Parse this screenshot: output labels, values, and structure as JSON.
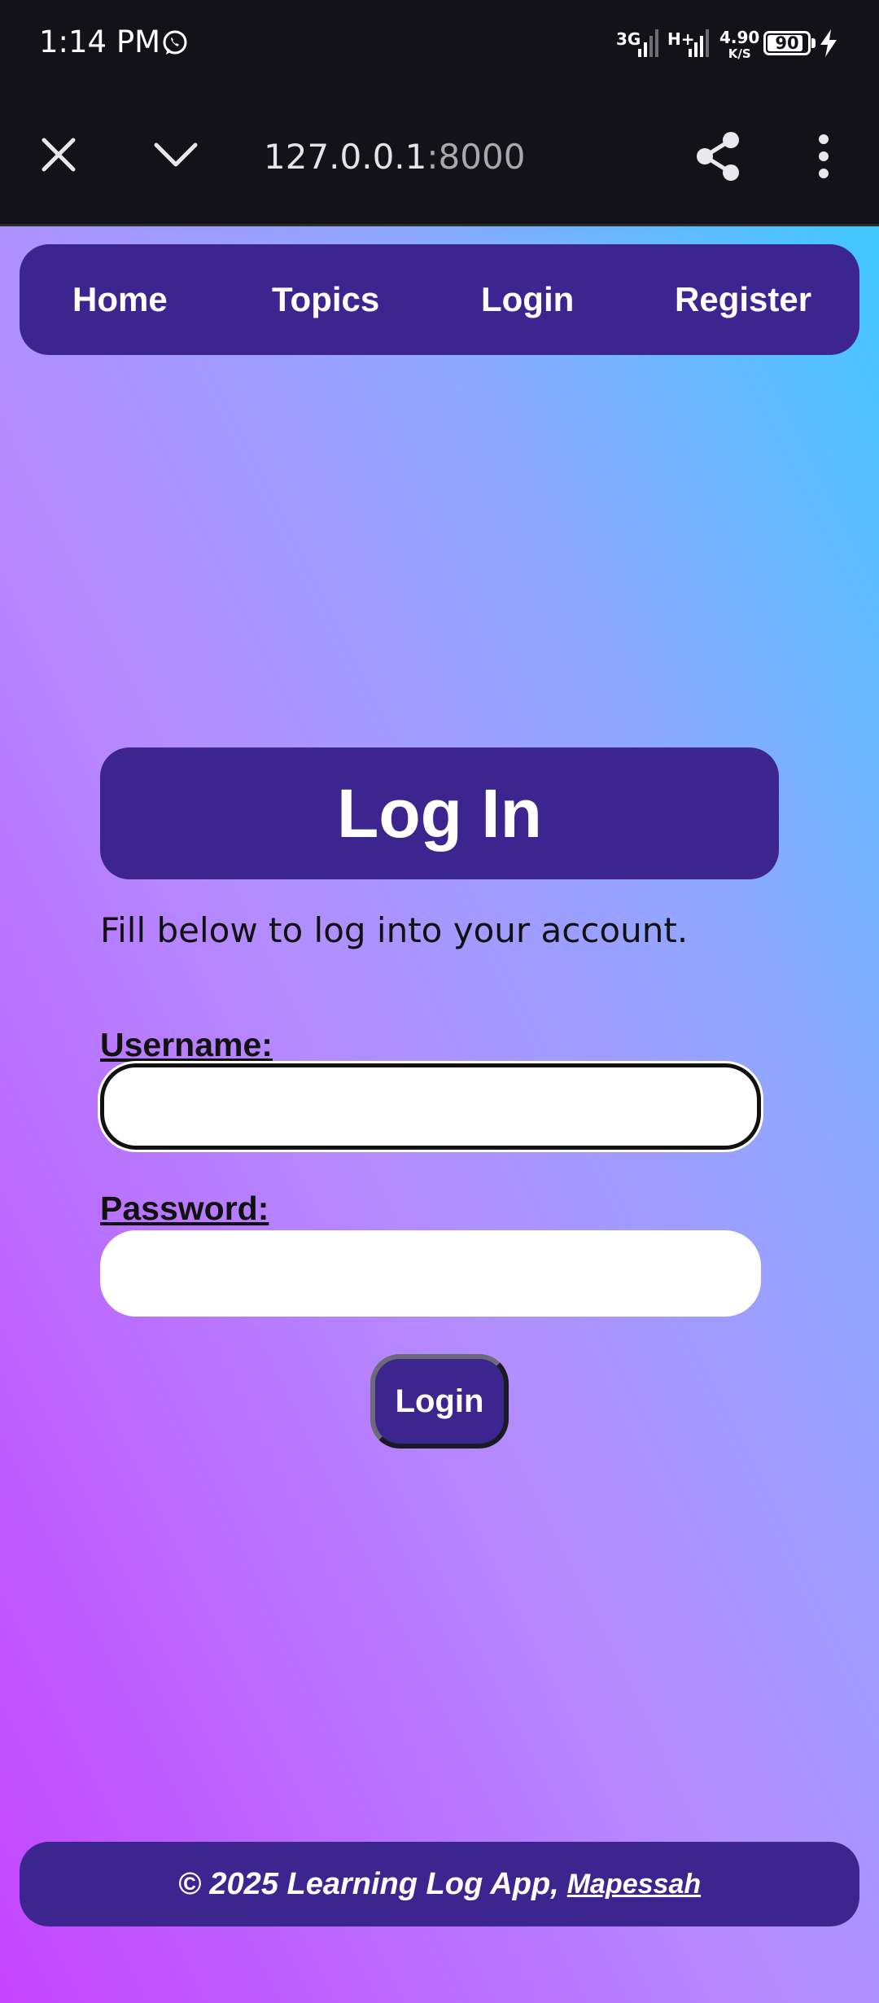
{
  "status_bar": {
    "time": "1:14 PM",
    "network_1": "3G",
    "network_2": "H+",
    "speed_value": "4.90",
    "speed_unit": "K/S",
    "battery": "90",
    "battery_level": 0.9
  },
  "browser": {
    "url_host": "127.0.0.1",
    "url_port": ":8000"
  },
  "nav": {
    "items": [
      {
        "label": "Home"
      },
      {
        "label": "Topics"
      },
      {
        "label": "Login"
      },
      {
        "label": "Register"
      }
    ]
  },
  "main": {
    "title": "Log In",
    "subtitle": "Fill below to log into your account.",
    "username_label": "Username:",
    "password_label": "Password:",
    "username_value": "",
    "password_value": "",
    "submit_label": "Login"
  },
  "footer": {
    "text": "© 2025 Learning Log App,",
    "link": "Mapessah"
  },
  "colors": {
    "accent": "#3d2590",
    "status_bar": "#121218"
  },
  "icons": [
    "whatsapp-icon",
    "close-icon",
    "chevron-down-icon",
    "share-icon",
    "more-vert-icon",
    "bolt-icon"
  ]
}
